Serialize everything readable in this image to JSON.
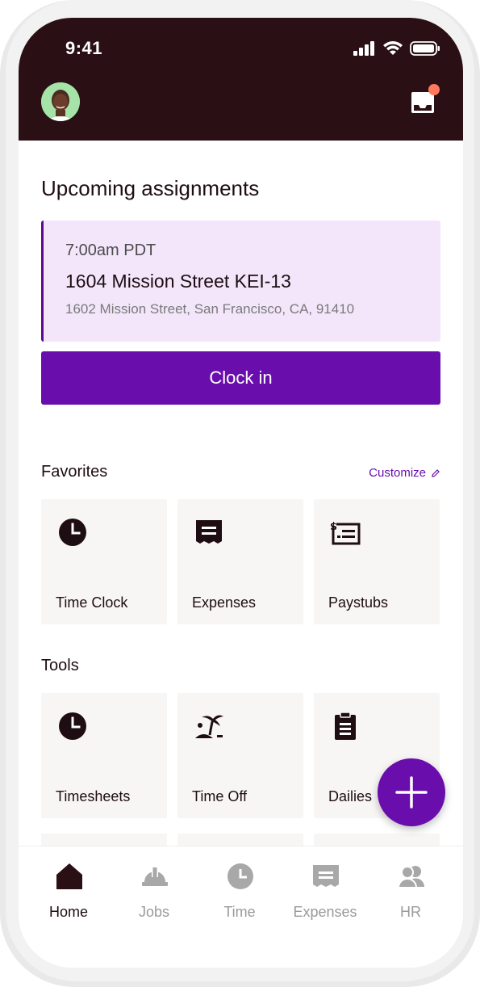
{
  "status_bar": {
    "time": "9:41"
  },
  "header": {
    "avatar": "avatar",
    "inbox_icon": "inbox-icon",
    "notification_dot": true
  },
  "assignments": {
    "title": "Upcoming assignments",
    "card": {
      "time": "7:00am PDT",
      "name": "1604 Mission Street KEI-13",
      "address": "1602 Mission Street, San Francisco, CA, 91410"
    },
    "clock_in_label": "Clock in"
  },
  "favorites": {
    "title": "Favorites",
    "customize_label": "Customize",
    "items": [
      {
        "label": "Time Clock",
        "icon": "clock-icon"
      },
      {
        "label": "Expenses",
        "icon": "receipt-icon"
      },
      {
        "label": "Paystubs",
        "icon": "paystub-icon"
      }
    ]
  },
  "tools": {
    "title": "Tools",
    "items": [
      {
        "label": "Timesheets",
        "icon": "clock-icon"
      },
      {
        "label": "Time Off",
        "icon": "island-icon"
      },
      {
        "label": "Dailies",
        "icon": "clipboard-icon"
      }
    ]
  },
  "fab": {
    "icon": "plus-icon"
  },
  "bottom_nav": {
    "items": [
      {
        "label": "Home",
        "icon": "home-icon",
        "active": true
      },
      {
        "label": "Jobs",
        "icon": "hardhat-icon",
        "active": false
      },
      {
        "label": "Time",
        "icon": "clock-icon",
        "active": false
      },
      {
        "label": "Expenses",
        "icon": "receipt-icon",
        "active": false
      },
      {
        "label": "HR",
        "icon": "people-icon",
        "active": false
      }
    ]
  },
  "colors": {
    "header_bg": "#2a0f14",
    "accent": "#6a0dad",
    "card_bg": "#f3e6fb",
    "tile_bg": "#f8f6f4",
    "notification": "#ff7a5c"
  }
}
